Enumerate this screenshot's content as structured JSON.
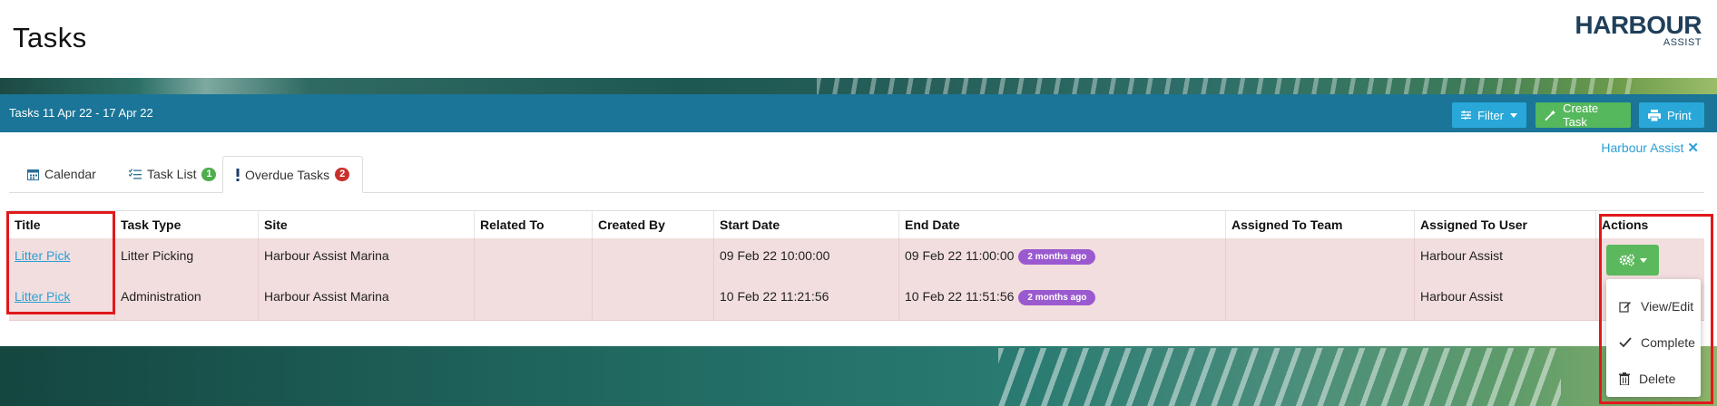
{
  "header": {
    "title": "Tasks",
    "logo_main": "HARBOUR",
    "logo_sub": "ASSIST"
  },
  "toolbar": {
    "title": "Tasks 11 Apr 22 - 17 Apr 22",
    "filter_label": "Filter",
    "create_label": "Create Task",
    "print_label": "Print"
  },
  "context_link": {
    "label": "Harbour Assist",
    "close": "✕"
  },
  "tabs": [
    {
      "label": "Calendar",
      "icon": "calendar-icon"
    },
    {
      "label": "Task List",
      "icon": "list-icon",
      "badge": "1"
    },
    {
      "label": "Overdue Tasks",
      "icon": "exclamation-icon",
      "badge": "2",
      "active": true
    }
  ],
  "table": {
    "columns": [
      "Title",
      "Task Type",
      "Site",
      "Related To",
      "Created By",
      "Start Date",
      "End Date",
      "Assigned To Team",
      "Assigned To User",
      "Actions"
    ],
    "rows": [
      {
        "title": "Litter Pick",
        "task_type": "Litter Picking",
        "site": "Harbour Assist Marina",
        "related_to": "",
        "created_by": "",
        "start_date": "09 Feb 22 10:00:00",
        "end_date": "09 Feb 22 11:00:00",
        "overdue_label": "2 months ago",
        "team": "",
        "user": "Harbour Assist"
      },
      {
        "title": "Litter Pick",
        "task_type": "Administration",
        "site": "Harbour Assist Marina",
        "related_to": "",
        "created_by": "",
        "start_date": "10 Feb 22 11:21:56",
        "end_date": "10 Feb 22 11:51:56",
        "overdue_label": "2 months ago",
        "team": "",
        "user": "Harbour Assist"
      }
    ]
  },
  "actions_menu": {
    "items": [
      "View/Edit",
      "Complete",
      "Delete"
    ]
  },
  "colors": {
    "toolbar": "#1a7598",
    "info_button": "#29a7d8",
    "success_button": "#55b85c",
    "overdue_row": "#f2dede",
    "overdue_badge": "#9b59d0",
    "highlight": "#e0191b"
  }
}
